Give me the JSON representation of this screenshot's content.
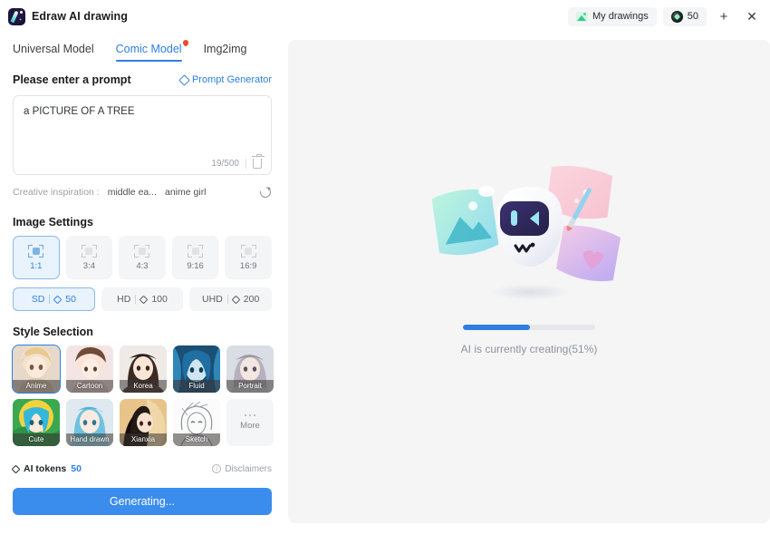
{
  "titlebar": {
    "app_name": "Edraw AI drawing",
    "logo_icon": "edraw-logo-icon",
    "my_drawings_label": "My drawings",
    "my_drawings_icon": "gallery-icon",
    "token_icon": "token-coin-icon",
    "token_count": "50",
    "add_label": "+",
    "close_label": "✕"
  },
  "tabs": [
    {
      "label": "Universal Model",
      "active": false,
      "badge": false
    },
    {
      "label": "Comic Model",
      "active": true,
      "badge": true
    },
    {
      "label": "Img2img",
      "active": false,
      "badge": false
    }
  ],
  "prompt": {
    "section_title": "Please enter a prompt",
    "generator_label": "Prompt Generator",
    "generator_icon": "sparkle-diamond-icon",
    "value": "a PICTURE OF A TREE",
    "placeholder": "Please enter a prompt",
    "counter": "19/500",
    "clear_icon": "trash-icon",
    "inspiration_label": "Creative inspiration :",
    "inspiration_items": [
      "middle ea...",
      "anime girl"
    ],
    "refresh_icon": "refresh-icon"
  },
  "image_settings": {
    "title": "Image Settings",
    "ratios": [
      {
        "label": "1:1",
        "selected": true
      },
      {
        "label": "3:4",
        "selected": false
      },
      {
        "label": "4:3",
        "selected": false
      },
      {
        "label": "9:16",
        "selected": false
      },
      {
        "label": "16:9",
        "selected": false
      }
    ],
    "qualities": [
      {
        "label": "SD",
        "cost": "50",
        "selected": true
      },
      {
        "label": "HD",
        "cost": "100",
        "selected": false
      },
      {
        "label": "UHD",
        "cost": "200",
        "selected": false
      }
    ]
  },
  "style_selection": {
    "title": "Style Selection",
    "styles": [
      {
        "label": "Anime",
        "selected": true
      },
      {
        "label": "Cartoon",
        "selected": false
      },
      {
        "label": "Korea",
        "selected": false
      },
      {
        "label": "Fluid",
        "selected": false
      },
      {
        "label": "Portrait",
        "selected": false
      },
      {
        "label": "Cute",
        "selected": false
      },
      {
        "label": "Hand drawn",
        "selected": false
      },
      {
        "label": "Xianxia",
        "selected": false
      },
      {
        "label": "Sketch",
        "selected": false
      }
    ],
    "more_label": "More",
    "more_icon": "ellipsis-icon"
  },
  "footer": {
    "tokens_label": "AI tokens",
    "tokens_icon": "sparkle-diamond-icon",
    "tokens_count": "50",
    "disclaimers_label": "Disclaimers",
    "disclaimers_icon": "info-icon",
    "generate_label": "Generating..."
  },
  "preview": {
    "illustration_icon": "ai-robot-illustration",
    "progress_percent": 51,
    "status_text": "AI is currently creating(51%)"
  },
  "colors": {
    "accent": "#2f7fe0",
    "button": "#3a8ced",
    "panel_bg": "#f5f5f6",
    "tile_bg": "#f4f5f7",
    "selected_bg": "#e9f3fe",
    "badge": "#ef4a2a"
  }
}
